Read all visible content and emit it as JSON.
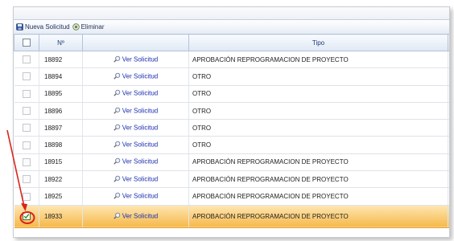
{
  "toolbar": {
    "new_label": "Nueva Solicitud",
    "delete_label": "Eliminar"
  },
  "columns": {
    "num": "Nº",
    "tipo": "Tipo"
  },
  "ver_label": "Ver Solicitud",
  "rows": [
    {
      "num": "18892",
      "tipo": "APROBACIÓN REPROGRAMACION DE PROYECTO",
      "checked": false
    },
    {
      "num": "18894",
      "tipo": "OTRO",
      "checked": false
    },
    {
      "num": "18895",
      "tipo": "OTRO",
      "checked": false
    },
    {
      "num": "18896",
      "tipo": "OTRO",
      "checked": false
    },
    {
      "num": "18897",
      "tipo": "OTRO",
      "checked": false
    },
    {
      "num": "18898",
      "tipo": "OTRO",
      "checked": false
    },
    {
      "num": "18915",
      "tipo": "APROBACIÓN REPROGRAMACION DE PROYECTO",
      "checked": false
    },
    {
      "num": "18922",
      "tipo": "APROBACIÓN REPROGRAMACION DE PROYECTO",
      "checked": false
    },
    {
      "num": "18925",
      "tipo": "APROBACIÓN REPROGRAMACION DE PROYECTO",
      "checked": false
    },
    {
      "num": "18933",
      "tipo": "APROBACIÓN REPROGRAMACION DE PROYECTO",
      "checked": true
    }
  ],
  "colors": {
    "selected_row": "#f6b84a",
    "annotation_arrow": "#d9241b",
    "link": "#1a2db0"
  },
  "icons": {
    "new": "save-icon",
    "delete": "delete-icon",
    "view": "magnifier-icon"
  }
}
